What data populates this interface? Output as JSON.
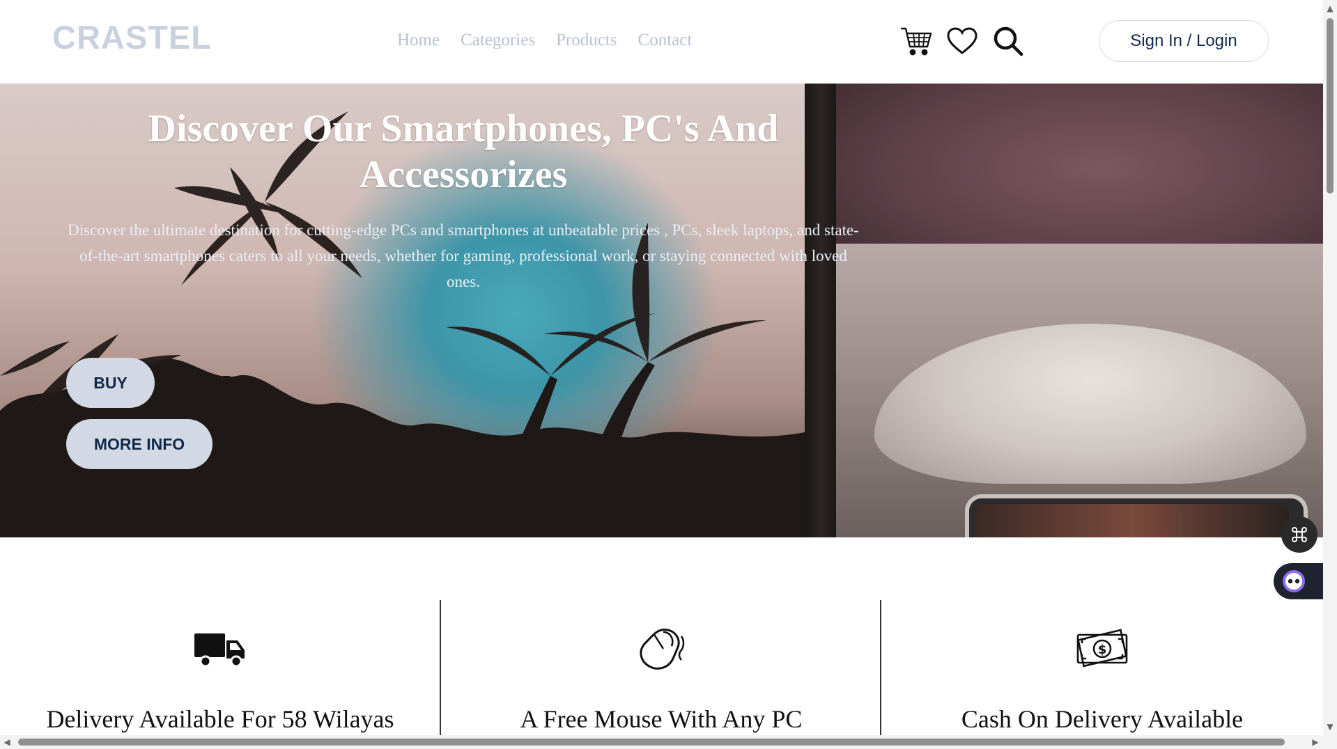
{
  "header": {
    "logo": "CRASTEL",
    "nav": [
      "Home",
      "Categories",
      "Products",
      "Contact"
    ],
    "icons": [
      "cart-icon",
      "heart-icon",
      "search-icon"
    ],
    "signin_label": "Sign In / Login"
  },
  "hero": {
    "title": "Discover Our Smartphones, PC's And Accessorizes",
    "subtitle": "Discover the ultimate destination for cutting-edge PCs and smartphones at unbeatable prices , PCs, sleek laptops, and state-of-the-art smartphones caters to all your needs, whether for gaming, professional work, or staying connected with loved ones.",
    "buy_label": "BUY",
    "more_label": "MORE INFO"
  },
  "features": [
    {
      "icon": "truck-icon",
      "label": "Delivery Available For 58 Wilayas"
    },
    {
      "icon": "mouse-icon",
      "label": "A Free Mouse With Any PC"
    },
    {
      "icon": "cash-icon",
      "label": "Cash On Delivery Available"
    }
  ],
  "colors": {
    "brand_text": "#0f2a4f",
    "button_bg": "#d3d9e4",
    "logo": "#c9d1df",
    "nav": "#b8c2d3"
  }
}
